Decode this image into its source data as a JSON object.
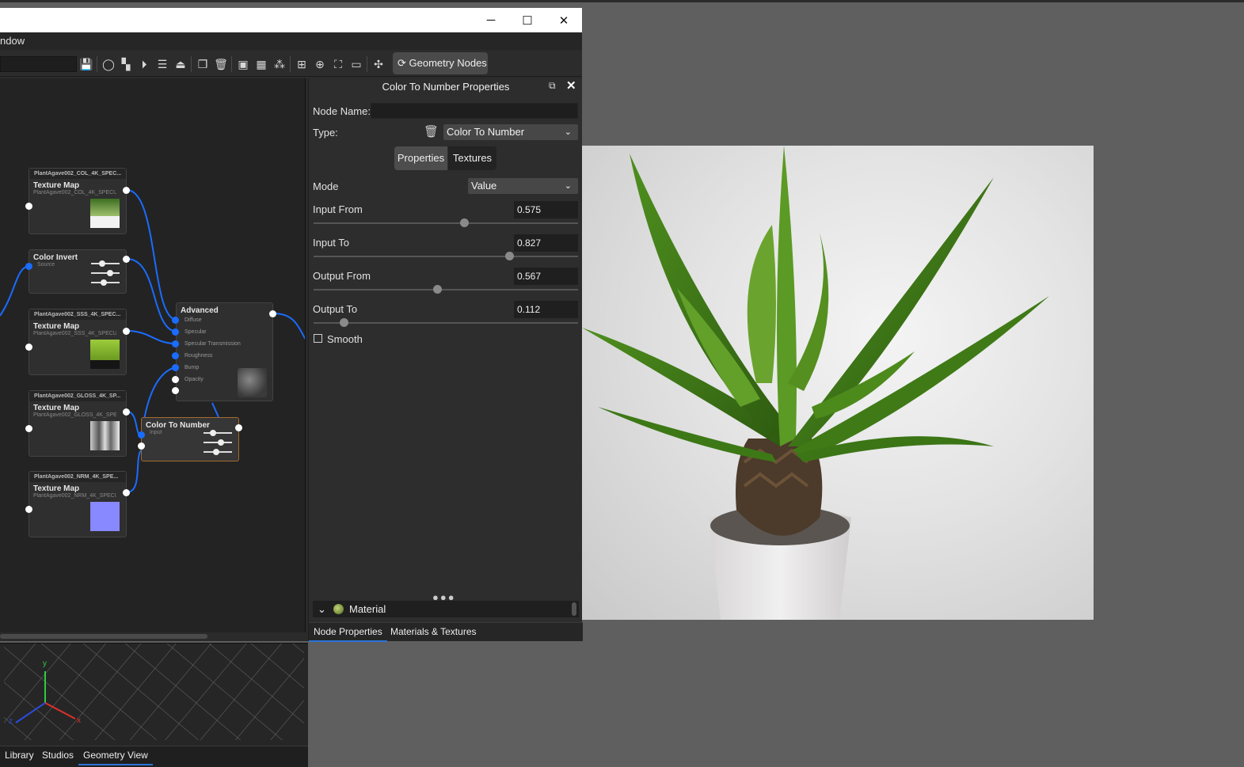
{
  "window": {
    "menu_fragment": "ndow",
    "minimize_label": "─",
    "maximize_label": "☐",
    "close_label": "✕"
  },
  "toolbar": {
    "geometry_nodes_label": "Geometry Nodes"
  },
  "nodes": {
    "col": {
      "header": "PlantAgave002_COL_4K_SPEC...",
      "title": "Texture Map",
      "sub": "PlantAgave002_COL_4K_SPECU..."
    },
    "invert": {
      "title": "Color Invert",
      "source": "Source"
    },
    "sss": {
      "header": "PlantAgave002_SSS_4K_SPEC...",
      "title": "Texture Map",
      "sub": "PlantAgave002_SSS_4K_SPECU..."
    },
    "gloss": {
      "header": "PlantAgave002_GLOSS_4K_SP...",
      "title": "Texture Map",
      "sub": "PlantAgave002_GLOSS_4K_SPEC..."
    },
    "nrm": {
      "header": "PlantAgave002_NRM_4K_SPE...",
      "title": "Texture Map",
      "sub": "PlantAgave002_NRM_4K_SPECU..."
    },
    "advanced": {
      "title": "Advanced",
      "inputs": [
        "Diffuse",
        "Specular",
        "Specular Transmission",
        "Roughness",
        "Bump",
        "Opacity"
      ]
    },
    "ctn": {
      "title": "Color To Number",
      "input": "Input"
    }
  },
  "props": {
    "title": "Color To Number Properties",
    "node_name_label": "Node Name:",
    "node_name_value": "",
    "type_label": "Type:",
    "type_value": "Color To Number",
    "tab_properties": "Properties",
    "tab_textures": "Textures",
    "mode_label": "Mode",
    "mode_value": "Value",
    "input_from_label": "Input From",
    "input_from_value": "0.575",
    "input_to_label": "Input To",
    "input_to_value": "0.827",
    "output_from_label": "Output From",
    "output_from_value": "0.567",
    "output_to_label": "Output To",
    "output_to_value": "0.112",
    "smooth_label": "Smooth",
    "material_label": "Material",
    "bottom_tab_node_props": "Node Properties",
    "bottom_tab_materials": "Materials & Textures"
  },
  "geo_view": {
    "axis_y": "y",
    "axis_x": "x",
    "axis_z": "z"
  },
  "bottom_tabs": [
    "Library",
    "Studios",
    "Geometry View"
  ],
  "colors": {
    "port_blue": "#1a6cff",
    "accent_tab": "#2b74d8",
    "node_selected_border": "#a36b2e"
  }
}
